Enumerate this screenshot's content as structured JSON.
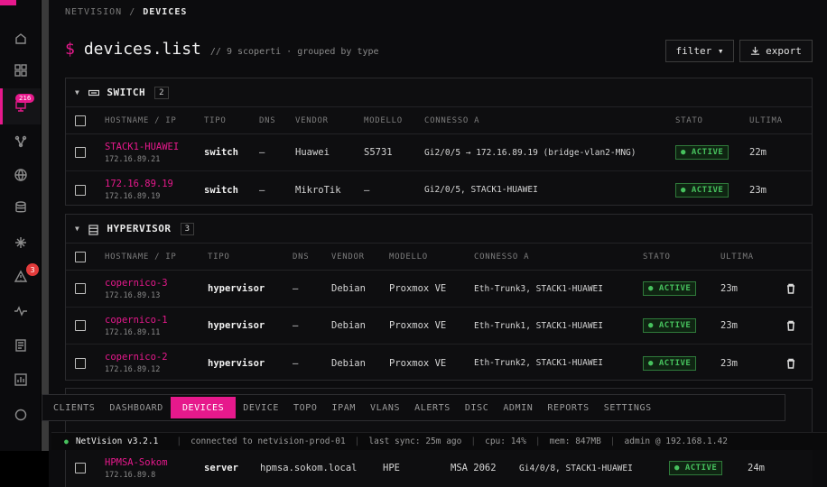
{
  "breadcrumb": {
    "root": "NETVISION",
    "separator": "/",
    "current": "DEVICES"
  },
  "title": {
    "prompt": "$",
    "text": "devices.list",
    "subtitle": "// 9 scoperti · grouped by type"
  },
  "actions": {
    "filter_label": "filter ▾",
    "export_label": "export",
    "export_icon": "download-icon"
  },
  "rail": {
    "items": [
      {
        "icon": "home-icon"
      },
      {
        "icon": "dashboard-icon"
      },
      {
        "icon": "devices-icon",
        "badge": "216",
        "active": true
      },
      {
        "icon": "topology-icon"
      },
      {
        "icon": "globe-icon"
      },
      {
        "icon": "layers-icon"
      },
      {
        "icon": "asterisk-icon"
      },
      {
        "icon": "alert-icon",
        "badge": "3"
      },
      {
        "icon": "pulse-icon"
      },
      {
        "icon": "document-icon"
      },
      {
        "icon": "chart-icon"
      },
      {
        "icon": "shield-icon"
      }
    ]
  },
  "columns_switch": [
    "HOSTNAME / IP",
    "TIPO",
    "DNS",
    "VENDOR",
    "MODELLO",
    "CONNESSO A",
    "STATO",
    "ULTIMA"
  ],
  "columns_hyper": [
    "HOSTNAME / IP",
    "TIPO",
    "DNS",
    "VENDOR",
    "MODELLO",
    "CONNESSO A",
    "STATO",
    "ULTIMA"
  ],
  "groups": {
    "switch": {
      "name": "SWITCH",
      "count": "2",
      "rows": [
        {
          "hostname": "STACK1-HUAWEI",
          "ip": "172.16.89.21",
          "type": "switch",
          "dns": "—",
          "vendor": "Huawei",
          "model": "S5731",
          "connected": "Gi2/0/5 → 172.16.89.19 (bridge-vlan2-MNG)",
          "status": "● ACTIVE",
          "last": "22m"
        },
        {
          "hostname": "172.16.89.19",
          "ip": "172.16.89.19",
          "type": "switch",
          "dns": "—",
          "vendor": "MikroTik",
          "model": "—",
          "connected": "Gi2/0/5, STACK1-HUAWEI",
          "status": "● ACTIVE",
          "last": "23m"
        }
      ]
    },
    "hypervisor": {
      "name": "HYPERVISOR",
      "count": "3",
      "rows": [
        {
          "hostname": "copernico-3",
          "ip": "172.16.89.13",
          "type": "hypervisor",
          "dns": "—",
          "vendor": "Debian",
          "model": "Proxmox VE",
          "connected": "Eth-Trunk3, STACK1-HUAWEI",
          "status": "● ACTIVE",
          "last": "23m"
        },
        {
          "hostname": "copernico-1",
          "ip": "172.16.89.11",
          "type": "hypervisor",
          "dns": "—",
          "vendor": "Debian",
          "model": "Proxmox VE",
          "connected": "Eth-Trunk1, STACK1-HUAWEI",
          "status": "● ACTIVE",
          "last": "23m"
        },
        {
          "hostname": "copernico-2",
          "ip": "172.16.89.12",
          "type": "hypervisor",
          "dns": "—",
          "vendor": "Debian",
          "model": "Proxmox VE",
          "connected": "Eth-Trunk2, STACK1-HUAWEI",
          "status": "● ACTIVE",
          "last": "23m"
        }
      ]
    },
    "server": {
      "rows": [
        {
          "hostname": "HPMSA-Sokom",
          "ip": "172.16.89.8",
          "type": "server",
          "dns": "hpmsa.sokom.local",
          "vendor": "HPE",
          "model": "MSA 2062",
          "connected": "Gi4/0/8, STACK1-HUAWEI",
          "status": "● ACTIVE",
          "last": "24m"
        }
      ]
    }
  },
  "tabs": [
    "CLIENTS",
    "DASHBOARD",
    "DEVICES",
    "DEVICE",
    "TOPO",
    "IPAM",
    "VLANS",
    "ALERTS",
    "DISC",
    "ADMIN",
    "REPORTS",
    "SETTINGS"
  ],
  "active_tab": "DEVICES",
  "status": {
    "dot": "●",
    "version": "NetVision v3.2.1",
    "connection": "connected to netvision-prod-01",
    "sync": "last sync: 25m ago",
    "cpu": "cpu: 14%",
    "mem": "mem: 847MB",
    "user": "admin @ 192.168.1.42"
  },
  "colors": {
    "accent": "#e6198c",
    "active_green": "#47c25e",
    "alert_red": "#e33b3b"
  }
}
